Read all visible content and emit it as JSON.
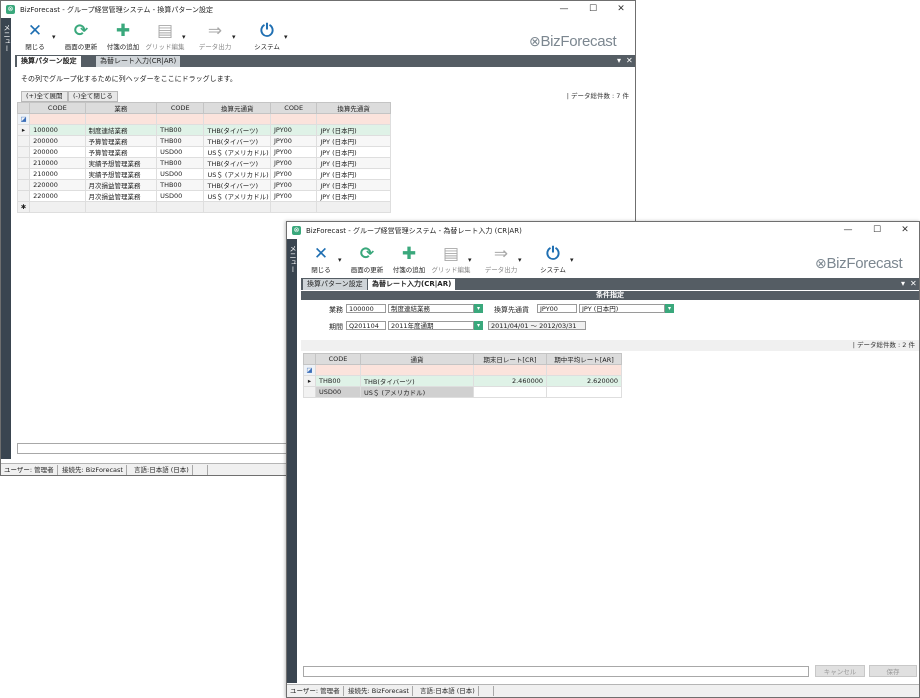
{
  "back_window": {
    "title": "BizForecast - グループ経営管理システム - 換算パターン設定",
    "side_label": "メニュー",
    "toolbar": [
      {
        "label": "閉じる",
        "icon": "close-icon",
        "glyph": "✕",
        "color": "#1f6fb2",
        "has_dropdown": true,
        "enabled": true
      },
      {
        "label": "画面の更新",
        "icon": "refresh-icon",
        "glyph": "⟳",
        "color": "#3aa87c",
        "has_dropdown": false,
        "enabled": true
      },
      {
        "label": "付箋の追加",
        "icon": "add-note-icon",
        "glyph": "✚",
        "color": "#3aa87c",
        "has_dropdown": false,
        "enabled": true
      },
      {
        "label": "グリッド編集",
        "icon": "grid-edit-icon",
        "glyph": "▤",
        "color": "#a8a8a8",
        "has_dropdown": true,
        "enabled": false
      },
      {
        "label": "データ出力",
        "icon": "data-output-icon",
        "glyph": "⇒",
        "color": "#a8a8a8",
        "has_dropdown": true,
        "enabled": false
      },
      {
        "label": "システム",
        "icon": "power-icon",
        "glyph": "⏻",
        "color": "#1f6fb2",
        "has_dropdown": true,
        "enabled": true
      }
    ],
    "logo_text": "BizForecast",
    "tabs": [
      {
        "label": "換算パターン設定",
        "active": true
      },
      {
        "label": "為替レート入力(CR|AR)",
        "active": false
      }
    ],
    "group_hint": "その列でグループ化するために列ヘッダーをここにドラッグします。",
    "expand_all": "(+)全て展開",
    "collapse_all": "(-)全て閉じる",
    "record_count": "| データ総件数 : 7 件",
    "grid": {
      "columns": [
        "CODE",
        "業務",
        "CODE",
        "換算元通貨",
        "CODE",
        "換算先通貨"
      ],
      "rows": [
        [
          "100000",
          "制度連結業務",
          "THB00",
          "THB(タイバーツ)",
          "JPY00",
          "JPY (日本円)"
        ],
        [
          "200000",
          "予算管理業務",
          "THB00",
          "THB(タイバーツ)",
          "JPY00",
          "JPY (日本円)"
        ],
        [
          "200000",
          "予算管理業務",
          "USD00",
          "US＄ (アメリカドル)",
          "JPY00",
          "JPY (日本円)"
        ],
        [
          "210000",
          "実績予想管理業務",
          "THB00",
          "THB(タイバーツ)",
          "JPY00",
          "JPY (日本円)"
        ],
        [
          "210000",
          "実績予想管理業務",
          "USD00",
          "US＄ (アメリカドル)",
          "JPY00",
          "JPY (日本円)"
        ],
        [
          "220000",
          "月次損益管理業務",
          "THB00",
          "THB(タイバーツ)",
          "JPY00",
          "JPY (日本円)"
        ],
        [
          "220000",
          "月次損益管理業務",
          "USD00",
          "US＄ (アメリカドル)",
          "JPY00",
          "JPY (日本円)"
        ]
      ]
    },
    "status": [
      "ユーザー: 管理者",
      "接続先: BizForecast",
      "言語:日本語 (日本)"
    ]
  },
  "front_window": {
    "title": "BizForecast - グループ経営管理システム - 為替レート入力 (CR|AR)",
    "side_label": "メニュー",
    "toolbar": [
      {
        "label": "閉じる",
        "icon": "close-icon",
        "glyph": "✕",
        "color": "#1f6fb2",
        "has_dropdown": true,
        "enabled": true
      },
      {
        "label": "画面の更新",
        "icon": "refresh-icon",
        "glyph": "⟳",
        "color": "#3aa87c",
        "has_dropdown": false,
        "enabled": true
      },
      {
        "label": "付箋の追加",
        "icon": "add-note-icon",
        "glyph": "✚",
        "color": "#3aa87c",
        "has_dropdown": false,
        "enabled": true
      },
      {
        "label": "グリッド編集",
        "icon": "grid-edit-icon",
        "glyph": "▤",
        "color": "#a8a8a8",
        "has_dropdown": true,
        "enabled": false
      },
      {
        "label": "データ出力",
        "icon": "data-output-icon",
        "glyph": "⇒",
        "color": "#a8a8a8",
        "has_dropdown": true,
        "enabled": false
      },
      {
        "label": "システム",
        "icon": "power-icon",
        "glyph": "⏻",
        "color": "#1f6fb2",
        "has_dropdown": true,
        "enabled": true
      }
    ],
    "logo_text": "BizForecast",
    "tabs": [
      {
        "label": "換算パターン設定",
        "active": false
      },
      {
        "label": "為替レート入力(CR|AR)",
        "active": true
      }
    ],
    "conditions": {
      "header": "条件指定",
      "business_label": "業務",
      "business_code": "100000",
      "business_name": "制度連結業務",
      "target_currency_label": "換算先通貨",
      "target_currency_code": "JPY00",
      "target_currency_name": "JPY (日本円)",
      "period_label": "期間",
      "period_code": "Q201104",
      "period_name": "2011年度通期",
      "period_range": "2011/04/01 ～ 2012/03/31"
    },
    "record_count": "| データ総件数 : 2 件",
    "grid": {
      "columns": [
        "CODE",
        "通貨",
        "期末日レート[CR]",
        "期中平均レート[AR]"
      ],
      "rows": [
        [
          "THB00",
          "THB(タイバーツ)",
          "2.460000",
          "2.620000"
        ],
        [
          "USD00",
          "US＄ (アメリカドル)",
          "",
          ""
        ]
      ]
    },
    "cancel_label": "キャンセル",
    "save_label": "保存",
    "status": [
      "ユーザー: 管理者",
      "接続先: BizForecast",
      "言語:日本語 (日本)"
    ]
  },
  "window_controls": {
    "minimize": "—",
    "maximize": "☐",
    "close": "✕"
  },
  "colors": {
    "accent": "#3aa87c",
    "tabbar": "#555d64",
    "selected_row": "#dff2e7",
    "filter_row": "#fbe3dc"
  }
}
